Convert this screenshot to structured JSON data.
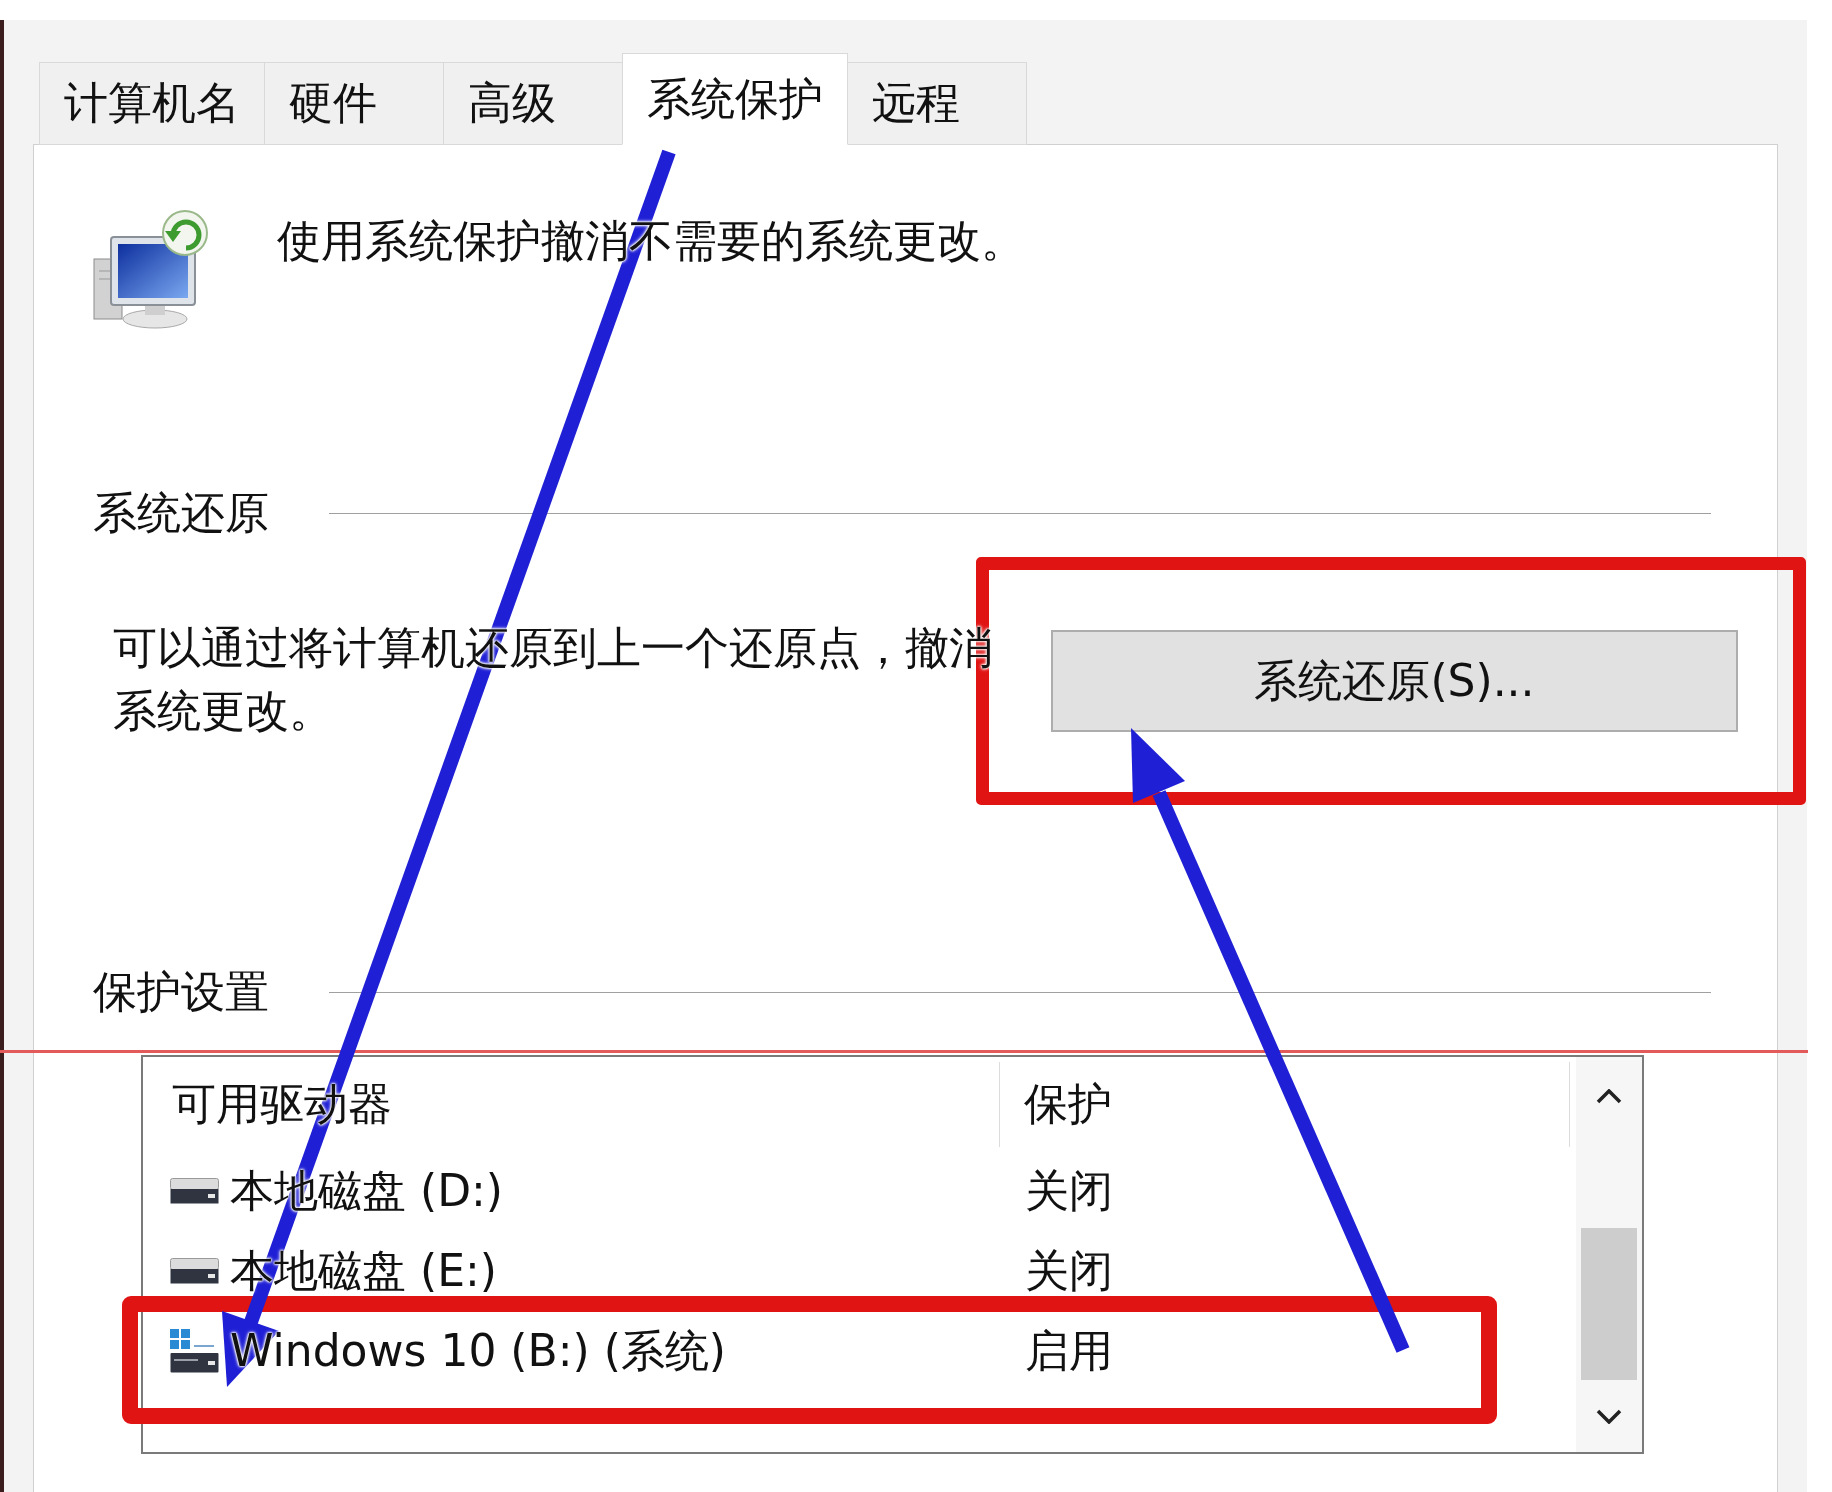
{
  "tabs": [
    {
      "label": "计算机名",
      "selected": false
    },
    {
      "label": "硬件",
      "selected": false
    },
    {
      "label": "高级",
      "selected": false
    },
    {
      "label": "系统保护",
      "selected": true
    },
    {
      "label": "远程",
      "selected": false
    }
  ],
  "intro": {
    "text": "使用系统保护撤消不需要的系统更改。"
  },
  "system_restore": {
    "heading": "系统还原",
    "description": "可以通过将计算机还原到上一个还原点，撤消系统更改。",
    "button": {
      "label": "系统还原(S)...",
      "highlighted": true
    }
  },
  "protection_settings": {
    "heading": "保护设置",
    "columns": [
      "可用驱动器",
      "保护"
    ],
    "drives": [
      {
        "kind": "local",
        "name": "本地磁盘 (D:)",
        "protection": "关闭",
        "highlighted": false
      },
      {
        "kind": "local",
        "name": "本地磁盘 (E:)",
        "protection": "关闭",
        "highlighted": false
      },
      {
        "kind": "system",
        "name": "Windows 10 (B:) (系统)",
        "protection": "启用",
        "highlighted": true
      }
    ]
  }
}
